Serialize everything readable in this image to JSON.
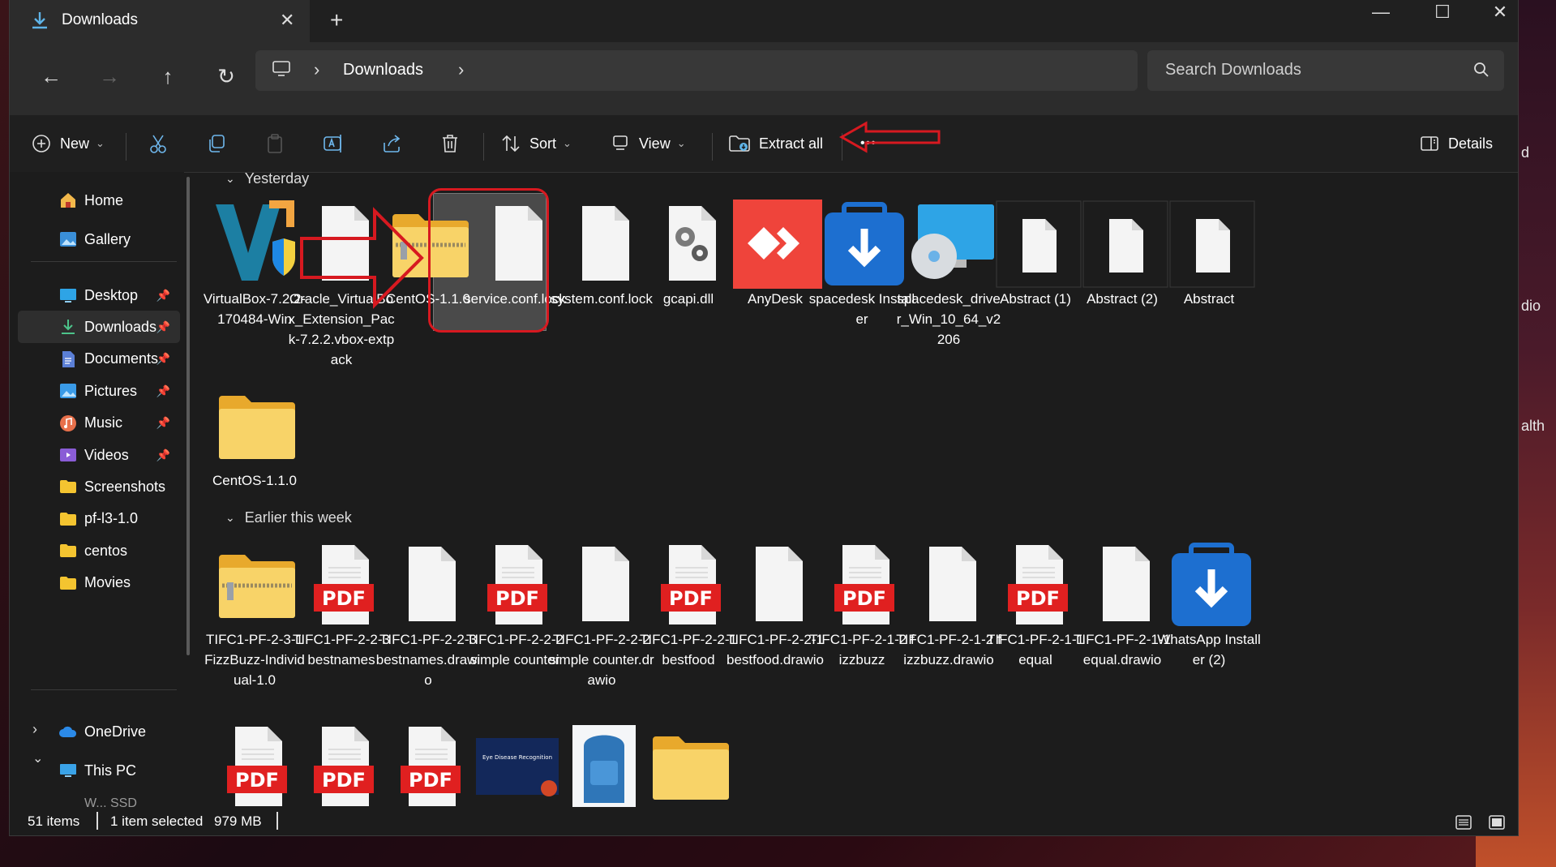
{
  "desktop": {
    "labels": [
      "d",
      "dio",
      "alth"
    ]
  },
  "window": {
    "tab_title": "Downloads",
    "tab_close": "✕",
    "tab_add": "+",
    "controls": {
      "minimize": "—",
      "maximize": "☐",
      "close": "✕"
    }
  },
  "nav": {
    "back": "←",
    "forward": "→",
    "up": "↑",
    "refresh": "↻",
    "breadcrumb": "Downloads",
    "sep": "›",
    "search_placeholder": "Search Downloads"
  },
  "toolbar": {
    "new": "New",
    "sort": "Sort",
    "view": "View",
    "extract_all": "Extract all",
    "more": "•••",
    "details": "Details",
    "caret": "⌄"
  },
  "sidebar": {
    "home": "Home",
    "gallery": "Gallery",
    "pinned": [
      {
        "label": "Desktop",
        "icon": "desktop-icon",
        "pinned": true
      },
      {
        "label": "Downloads",
        "icon": "downloads-icon",
        "pinned": true,
        "active": true
      },
      {
        "label": "Documents",
        "icon": "documents-icon",
        "pinned": true
      },
      {
        "label": "Pictures",
        "icon": "pictures-icon",
        "pinned": true
      },
      {
        "label": "Music",
        "icon": "music-icon",
        "pinned": true
      },
      {
        "label": "Videos",
        "icon": "videos-icon",
        "pinned": true
      },
      {
        "label": "Screenshots",
        "icon": "folder-icon"
      },
      {
        "label": "pf-l3-1.0",
        "icon": "folder-icon"
      },
      {
        "label": "centos",
        "icon": "folder-icon"
      },
      {
        "label": "Movies",
        "icon": "folder-icon"
      }
    ],
    "onedrive": "OneDrive",
    "thispc": "This PC",
    "next_partial": "W...  SSD",
    "pin_glyph": "📌",
    "expand": "›",
    "collapse": "⌄"
  },
  "groups": {
    "yesterday": "Yesterday",
    "earlier": "Earlier this week"
  },
  "files_yesterday": [
    {
      "name": "VirtualBox-7.2.2-170484-Win",
      "kind": "virtualbox"
    },
    {
      "name": "Oracle_VirtualBox_Extension_Pack-7.2.2.vbox-extpack",
      "kind": "blank"
    },
    {
      "name": "CentOS-1.1.0",
      "kind": "zip",
      "selected": true
    },
    {
      "name": "service.conf.lock",
      "kind": "blank"
    },
    {
      "name": "system.conf.lock",
      "kind": "blank"
    },
    {
      "name": "gcapi.dll",
      "kind": "dll"
    },
    {
      "name": "AnyDesk",
      "kind": "anydesk"
    },
    {
      "name": "spacedesk Installer",
      "kind": "installer"
    },
    {
      "name": "spacedesk_driver_Win_10_64_v2206",
      "kind": "disk"
    },
    {
      "name": "Abstract (1)",
      "kind": "blank-thumb"
    },
    {
      "name": "Abstract (2)",
      "kind": "blank-thumb"
    },
    {
      "name": "Abstract",
      "kind": "blank-thumb"
    },
    {
      "name": "CentOS-1.1.0",
      "kind": "folder"
    }
  ],
  "files_earlier": [
    {
      "name": "TIFC1-PF-2-3-1 FizzBuzz-Individual-1.0",
      "kind": "zip"
    },
    {
      "name": "TIFC1-PF-2-2-3 bestnames",
      "kind": "pdf"
    },
    {
      "name": "TIFC1-PF-2-2-3 bestnames.drawio",
      "kind": "blank"
    },
    {
      "name": "TIFC1-PF-2-2-2 simple counter",
      "kind": "pdf"
    },
    {
      "name": "TIFC1-PF-2-2-2 simple counter.drawio",
      "kind": "blank"
    },
    {
      "name": "TIFC1-PF-2-2-1 bestfood",
      "kind": "pdf"
    },
    {
      "name": "TIFC1-PF-2-2-1 bestfood.drawio",
      "kind": "blank"
    },
    {
      "name": "TIFC1-PF-2-1-2 fizzbuzz",
      "kind": "pdf"
    },
    {
      "name": "TIFC1-PF-2-1-2 fizzbuzz.drawio",
      "kind": "blank"
    },
    {
      "name": "TIFC1-PF-2-1-1 equal",
      "kind": "pdf"
    },
    {
      "name": "TIFC1-PF-2-1-1 equal.drawio",
      "kind": "blank"
    },
    {
      "name": "WhatsApp Installer (2)",
      "kind": "installer"
    }
  ],
  "files_row3": [
    {
      "kind": "pdf"
    },
    {
      "kind": "pdf"
    },
    {
      "kind": "pdf"
    },
    {
      "kind": "pptx-thumb",
      "thumb_text": "Eye Disease Recognition Using Convolutional Neural Networks"
    },
    {
      "kind": "photo"
    },
    {
      "kind": "folder"
    }
  ],
  "pdf_label": "PDF",
  "status": {
    "items": "51 items",
    "selected": "1 item selected",
    "size": "979 MB"
  },
  "colors": {
    "accent_red": "#d71920",
    "folder": "#f4c430",
    "selection": "#4a4a4a"
  }
}
